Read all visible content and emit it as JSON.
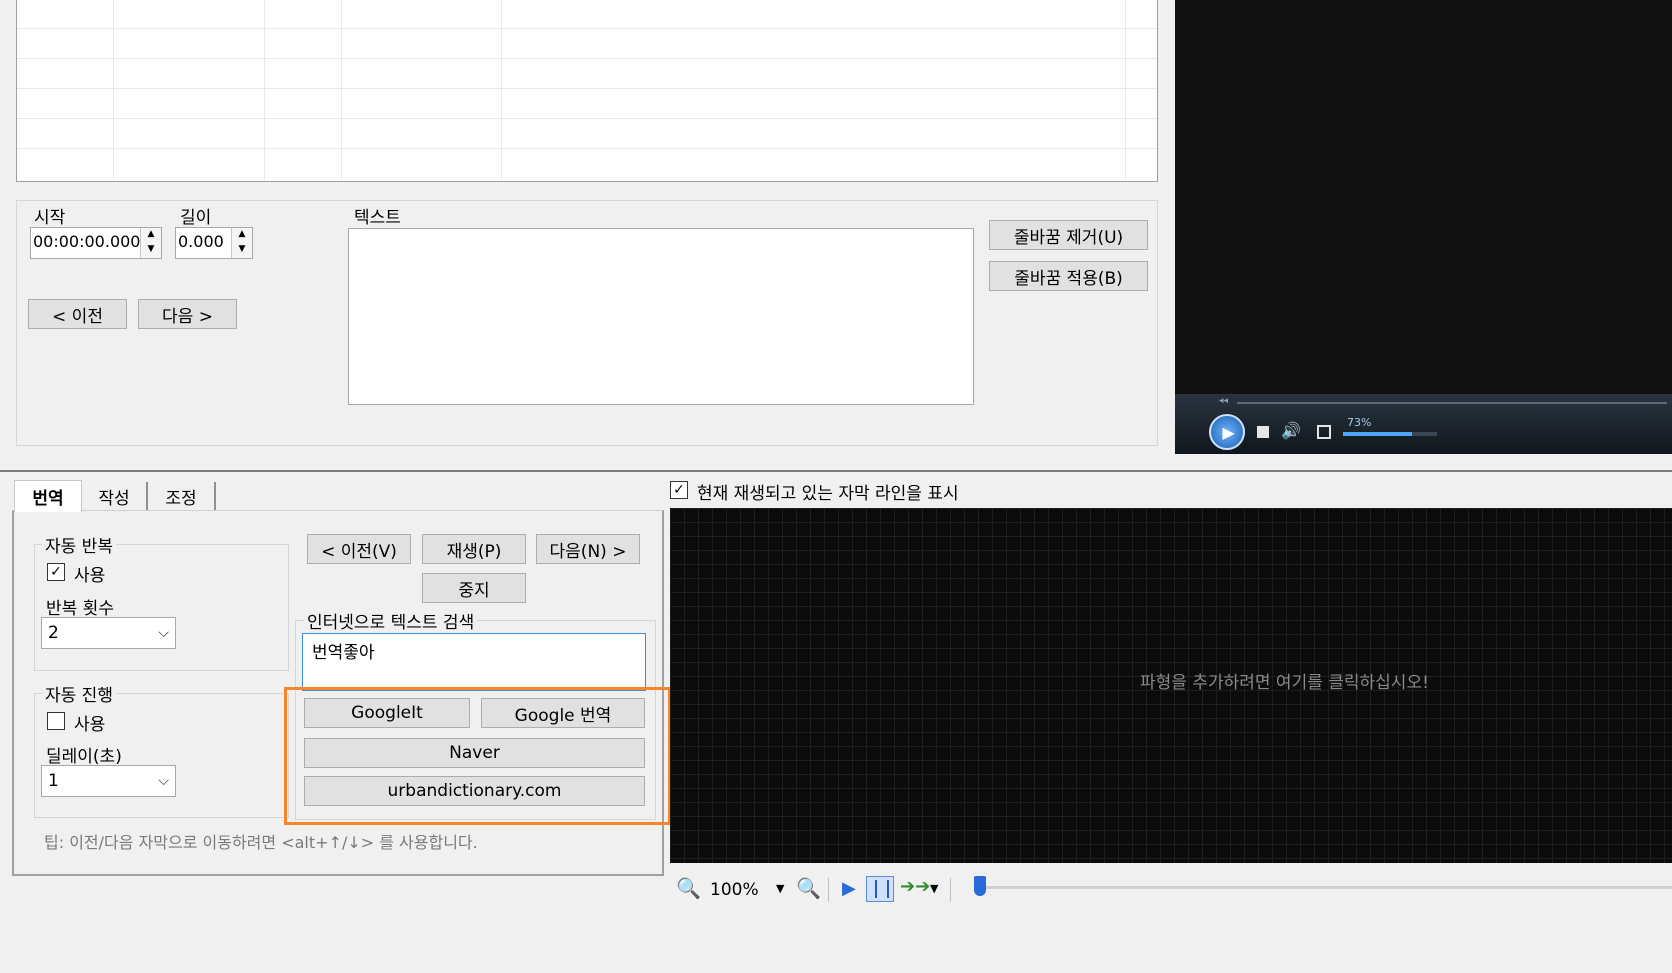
{
  "editor": {
    "start_label": "시작",
    "start_value": "00:00:00.000",
    "length_label": "길이",
    "length_value": "0.000",
    "text_label": "텍스트",
    "prev_label": "< 이전",
    "next_label": "다음 >",
    "remove_linebreak_label": "줄바꿈 제거(U)",
    "apply_linebreak_label": "줄바꿈 적용(B)"
  },
  "player": {
    "volume_percent": "73%"
  },
  "tabs": [
    {
      "label": "번역"
    },
    {
      "label": "작성"
    },
    {
      "label": "조정"
    }
  ],
  "translate": {
    "auto_repeat_title": "자동 반복",
    "auto_repeat_use": "사용",
    "repeat_count_label": "반복 횟수",
    "repeat_count_value": "2",
    "auto_advance_title": "자동 진행",
    "auto_advance_use": "사용",
    "delay_label": "딜레이(초)",
    "delay_value": "1",
    "prev_btn": "< 이전(V)",
    "play_btn": "재생(P)",
    "next_btn": "다음(N) >",
    "stop_btn": "중지",
    "search_title": "인터넷으로 텍스트 검색",
    "search_text": "번역좋아",
    "googleit_btn": "GoogleIt",
    "google_translate_btn": "Google 번역",
    "naver_btn": "Naver",
    "urban_btn": "urbandictionary.com",
    "tip": "팁: 이전/다음 자막으로 이동하려면 <alt+↑/↓> 를 사용합니다."
  },
  "waveform": {
    "show_current_line_label": "현재 재생되고 있는 자막 라인을 표시",
    "placeholder": "파형을 추가하려면 여기를 클릭하십시오!",
    "zoom_value": "100%"
  },
  "colors": {
    "highlight": "#f5862a",
    "waveform_bg": "#0b0b0b",
    "video_bg": "#111111"
  }
}
